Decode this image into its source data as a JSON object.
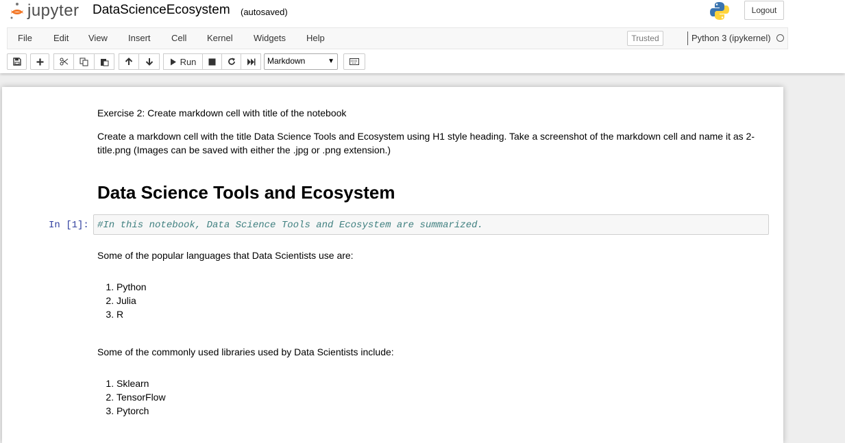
{
  "header": {
    "logo_text": "jupyter",
    "notebook_name": "DataScienceEcosystem",
    "autosave_status": "(autosaved)",
    "logout_label": "Logout"
  },
  "menu": {
    "items": [
      "File",
      "Edit",
      "View",
      "Insert",
      "Cell",
      "Kernel",
      "Widgets",
      "Help"
    ],
    "trusted_label": "Trusted",
    "kernel_name": "Python 3 (ipykernel)"
  },
  "toolbar": {
    "run_label": "Run",
    "cell_type": "Markdown"
  },
  "cells": {
    "exercise_title": "Exercise 2: Create markdown cell with title of the notebook",
    "exercise_desc": "Create a markdown cell with the title Data Science Tools and Ecosystem using H1 style heading. Take a screenshot of the markdown cell and name it as 2-title.png (Images can be saved with either the .jpg or .png extension.)",
    "heading": "Data Science Tools and Ecosystem",
    "code_prompt": "In [1]:",
    "code_comment": "#In this notebook, Data Science Tools and Ecosystem are summarized.",
    "languages_intro": "Some of the popular languages that Data Scientists use are:",
    "languages": [
      "Python",
      "Julia",
      "R"
    ],
    "libraries_intro": "Some of the commonly used libraries used by Data Scientists include:",
    "libraries": [
      "Sklearn",
      "TensorFlow",
      "Pytorch"
    ]
  },
  "colors": {
    "jupyter_orange": "#f37726",
    "prompt_blue": "#303f9f",
    "comment_teal": "#408080"
  }
}
